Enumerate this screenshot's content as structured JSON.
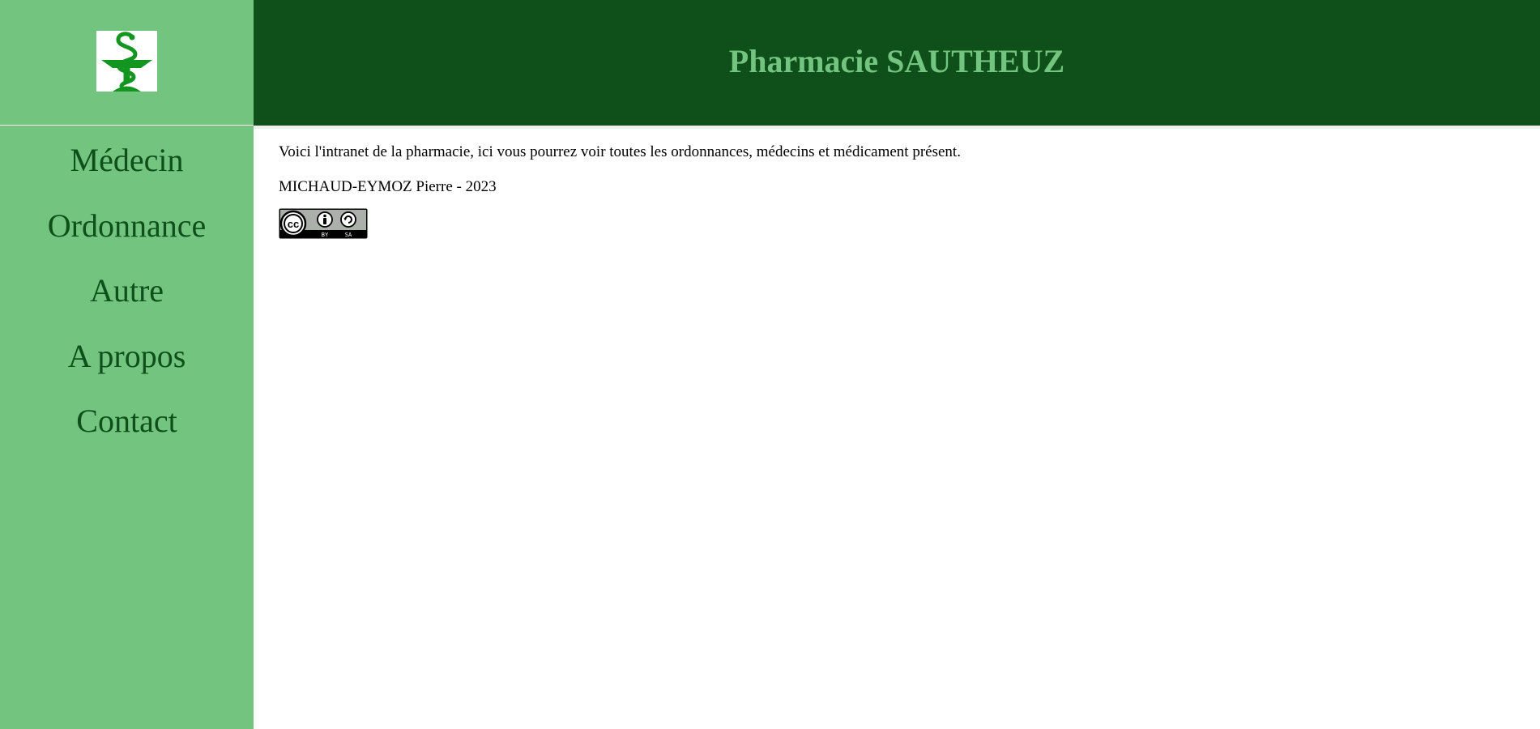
{
  "header": {
    "title": "Pharmacie SAUTHEUZ"
  },
  "sidebar": {
    "logo_icon": "pharmacy-caduceus-icon",
    "items": [
      {
        "label": "Médecin"
      },
      {
        "label": "Ordonnance"
      },
      {
        "label": "Autre"
      },
      {
        "label": "A propos"
      },
      {
        "label": "Contact"
      }
    ]
  },
  "main": {
    "intro_text": "Voici l'intranet de la pharmacie, ici vous pourrez voir toutes les ordonnances, médecins et médicament présent.",
    "author_line": "MICHAUD-EYMOZ Pierre - 2023",
    "license_badge": {
      "icon": "cc-by-sa-icon",
      "by": "BY",
      "sa": "SA"
    }
  },
  "colors": {
    "sidebar_bg": "#72c47f",
    "header_bg": "#0e4f1a",
    "title_color": "#72c47f",
    "nav_text": "#0e4f1a",
    "logo_green": "#12961f"
  }
}
